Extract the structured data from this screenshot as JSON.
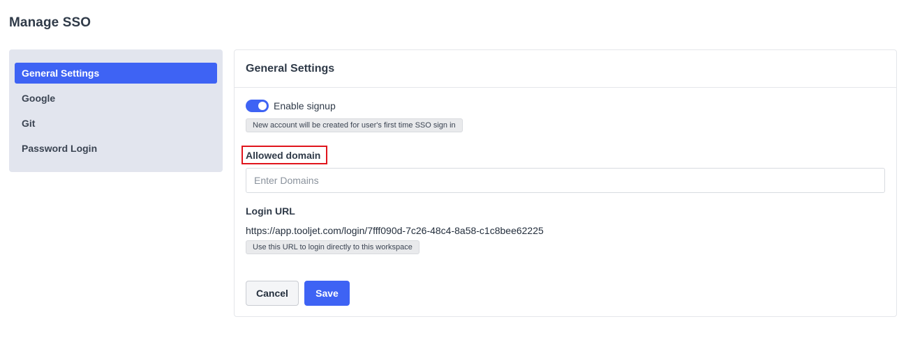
{
  "page": {
    "title": "Manage SSO"
  },
  "sidebar": {
    "items": [
      {
        "label": "General Settings",
        "active": true
      },
      {
        "label": "Google",
        "active": false
      },
      {
        "label": "Git",
        "active": false
      },
      {
        "label": "Password Login",
        "active": false
      }
    ]
  },
  "general": {
    "title": "General Settings",
    "enable_signup": {
      "label": "Enable signup",
      "enabled": true,
      "hint": "New account will be created for user's first time SSO sign in"
    },
    "allowed_domain": {
      "label": "Allowed domain",
      "value": "",
      "placeholder": "Enter Domains"
    },
    "login_url": {
      "label": "Login URL",
      "value": "https://app.tooljet.com/login/7fff090d-7c26-48c4-8a58-c1c8bee62225",
      "hint": "Use this URL to login directly to this workspace"
    },
    "cancel_label": "Cancel",
    "save_label": "Save"
  },
  "colors": {
    "accent": "#3e63f4",
    "sidebar_bg": "#e2e5ee",
    "highlight": "#e0141c"
  }
}
